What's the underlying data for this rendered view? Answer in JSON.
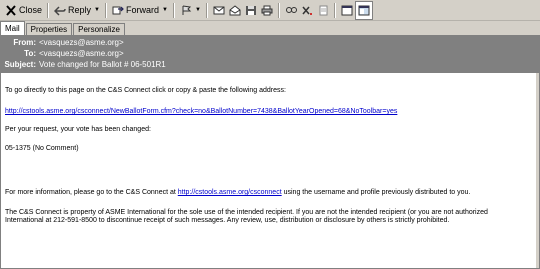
{
  "toolbar": {
    "close": "Close",
    "reply": "Reply",
    "forward": "Forward"
  },
  "tabs": [
    "Mail",
    "Properties",
    "Personalize"
  ],
  "header": {
    "from_label": "From:",
    "from_value": "<vasquezs@asme.org>",
    "to_label": "To:",
    "to_value": "<vasquezs@asme.org>",
    "subject_label": "Subject:",
    "subject_value": "Vote changed for Ballot # 06-501R1"
  },
  "body": {
    "intro": "To go directly to this page on the C&S Connect click or copy & paste the following address:",
    "url": "http://cstools.asme.org/csconnect/NewBallotForm.cfm?check=no&BallotNumber=7438&BallotYearOpened=68&NoToolbar=yes",
    "request": "Per your request, your vote has been changed:",
    "vote": "05-1375 (No Comment)",
    "more_prefix": "For more information, please go to the C&S Connect at ",
    "more_link": "http://cstools.asme.org/csconnect",
    "more_suffix": " using the username and profile previously distributed to you.",
    "legal1": "The C&S Connect is property of ASME International for the sole use of the intended recipient.  If you are not the intended recipient (or you are not authorized",
    "legal2": "International at 212-591-8500 to discontinue receipt of such messages.  Any review, use, distribution or disclosure by others is strictly prohibited."
  }
}
